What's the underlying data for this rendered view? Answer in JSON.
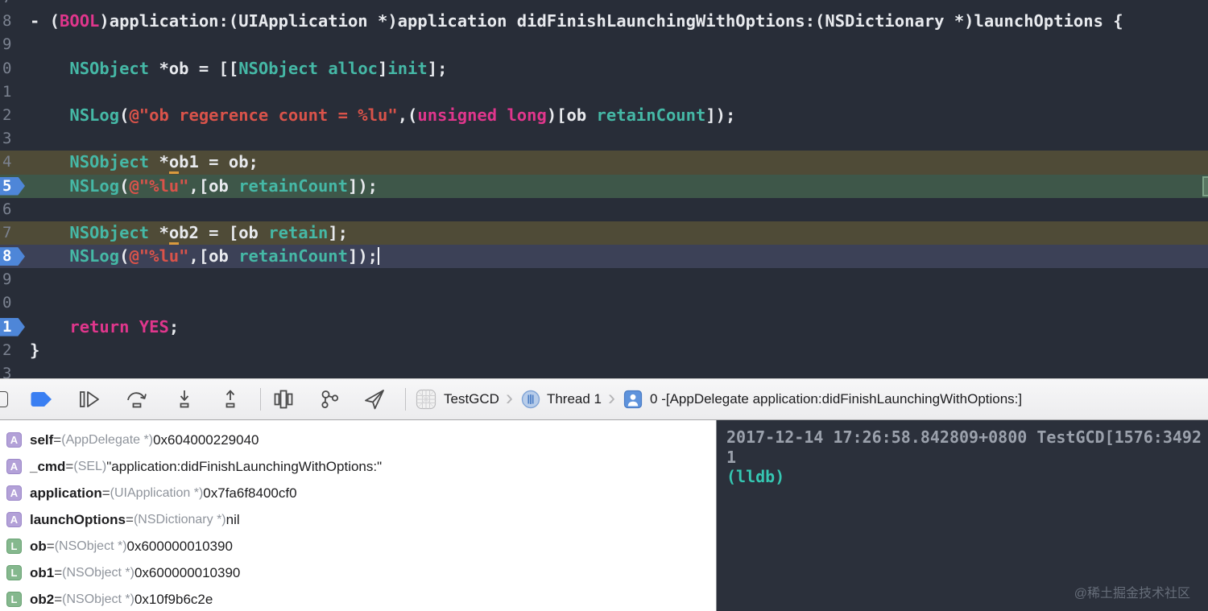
{
  "colors": {
    "editor_background": "#282d38",
    "keyword_pink": "#e0368c",
    "type_teal": "#45b8a6",
    "string_red": "#d9534a",
    "plain_text": "#e8eaee",
    "breakpoint_blue": "#4e86d8",
    "line_highlight_olive": "#4f4b37",
    "line_highlight_green": "#3e5749",
    "line_highlight_blue": "#3c4157",
    "toolbar_background": "#ececee",
    "console_background": "#2b303b",
    "console_prompt_teal": "#35c7b2",
    "breakpoints_flag_blue": "#3a7ff2"
  },
  "editor": {
    "lines": [
      {
        "num": "7",
        "partial": true,
        "segments": []
      },
      {
        "num": "8",
        "segments": [
          [
            "p",
            "- ("
          ],
          [
            "k",
            "BOOL"
          ],
          [
            "p",
            ")application:(UIApplication *)application didFinishLaunchingWithOptions:(NSDictionary *)launchOptions {"
          ]
        ]
      },
      {
        "num": "9",
        "segments": []
      },
      {
        "num": "0",
        "segments": [
          [
            "p",
            "    "
          ],
          [
            "t",
            "NSObject"
          ],
          [
            "p",
            " *ob = [["
          ],
          [
            "t",
            "NSObject"
          ],
          [
            "p",
            " "
          ],
          [
            "t",
            "alloc"
          ],
          [
            "p",
            "]"
          ],
          [
            "t",
            "init"
          ],
          [
            "p",
            "];"
          ]
        ]
      },
      {
        "num": "1",
        "segments": []
      },
      {
        "num": "2",
        "segments": [
          [
            "p",
            "    "
          ],
          [
            "t",
            "NSLog"
          ],
          [
            "p",
            "("
          ],
          [
            "s",
            "@\"ob regerence count = %lu\""
          ],
          [
            "p",
            ",("
          ],
          [
            "k",
            "unsigned long"
          ],
          [
            "p",
            ")[ob "
          ],
          [
            "t",
            "retainCount"
          ],
          [
            "p",
            "]);"
          ]
        ]
      },
      {
        "num": "3",
        "segments": []
      },
      {
        "num": "4",
        "highlight": "olive",
        "segments": [
          [
            "p",
            "    "
          ],
          [
            "t",
            "NSObject"
          ],
          [
            "p",
            " *"
          ],
          [
            "u",
            "o"
          ],
          [
            "p",
            "b1 = ob;"
          ]
        ]
      },
      {
        "num": "5",
        "breakpoint": true,
        "highlight": "green",
        "tag": true,
        "segments": [
          [
            "p",
            "    "
          ],
          [
            "t",
            "NSLog"
          ],
          [
            "p",
            "("
          ],
          [
            "s",
            "@\"%lu\""
          ],
          [
            "p",
            ",[ob "
          ],
          [
            "t",
            "retainCount"
          ],
          [
            "p",
            "]);"
          ]
        ]
      },
      {
        "num": "6",
        "segments": []
      },
      {
        "num": "7",
        "highlight": "olive",
        "segments": [
          [
            "p",
            "    "
          ],
          [
            "t",
            "NSObject"
          ],
          [
            "p",
            " *"
          ],
          [
            "u",
            "o"
          ],
          [
            "p",
            "b2 = [ob "
          ],
          [
            "t",
            "retain"
          ],
          [
            "p",
            "];"
          ]
        ]
      },
      {
        "num": "8",
        "breakpoint": true,
        "highlight": "blue",
        "caret": true,
        "segments": [
          [
            "p",
            "    "
          ],
          [
            "t",
            "NSLog"
          ],
          [
            "p",
            "("
          ],
          [
            "s",
            "@\"%lu\""
          ],
          [
            "p",
            ",[ob "
          ],
          [
            "t",
            "retainCount"
          ],
          [
            "p",
            "]);"
          ]
        ]
      },
      {
        "num": "9",
        "segments": []
      },
      {
        "num": "0",
        "segments": []
      },
      {
        "num": "1",
        "breakpoint": true,
        "segments": [
          [
            "p",
            "    "
          ],
          [
            "k",
            "return"
          ],
          [
            "p",
            " "
          ],
          [
            "k",
            "YES"
          ],
          [
            "p",
            ";"
          ]
        ]
      },
      {
        "num": "2",
        "segments": [
          [
            "p",
            "}"
          ]
        ]
      },
      {
        "num": "3",
        "segments": []
      }
    ]
  },
  "toolbar": {
    "buttons": [
      {
        "name": "partial-edge-button"
      },
      {
        "name": "breakpoints-toggle"
      },
      {
        "name": "continue-execution"
      },
      {
        "name": "step-over"
      },
      {
        "name": "step-into"
      },
      {
        "name": "step-out"
      },
      {
        "name": "separator"
      },
      {
        "name": "debug-view-hierarchy"
      },
      {
        "name": "memory-graph"
      },
      {
        "name": "simulate-location"
      },
      {
        "name": "separator"
      }
    ],
    "process_label": "TestGCD",
    "thread_label": "Thread 1",
    "frame_label": "0 -[AppDelegate application:didFinishLaunchingWithOptions:]"
  },
  "variables": {
    "rows": [
      {
        "badge": "A",
        "name": "self",
        "type": "(AppDelegate *)",
        "value": "0x604000229040"
      },
      {
        "badge": "A",
        "name": "_cmd",
        "type": "(SEL)",
        "value": "\"application:didFinishLaunchingWithOptions:\""
      },
      {
        "badge": "A",
        "name": "application",
        "type": "(UIApplication *)",
        "value": "0x7fa6f8400cf0"
      },
      {
        "badge": "A",
        "name": "launchOptions",
        "type": "(NSDictionary *)",
        "value": "nil"
      },
      {
        "badge": "L",
        "name": "ob",
        "type": "(NSObject *)",
        "value": "0x600000010390"
      },
      {
        "badge": "L",
        "name": "ob1",
        "type": "(NSObject *)",
        "value": "0x600000010390"
      },
      {
        "badge": "L",
        "name": "ob2",
        "type": "(NSObject *)",
        "value": "0x10f9b6c2e"
      }
    ]
  },
  "console": {
    "lines": [
      {
        "style": "log",
        "text": "2017-12-14 17:26:58.842809+0800 TestGCD[1576:3492"
      },
      {
        "style": "log",
        "text": "1"
      },
      {
        "style": "prompt",
        "text": "(lldb) "
      }
    ],
    "watermark": "@稀土掘金技术社区"
  }
}
